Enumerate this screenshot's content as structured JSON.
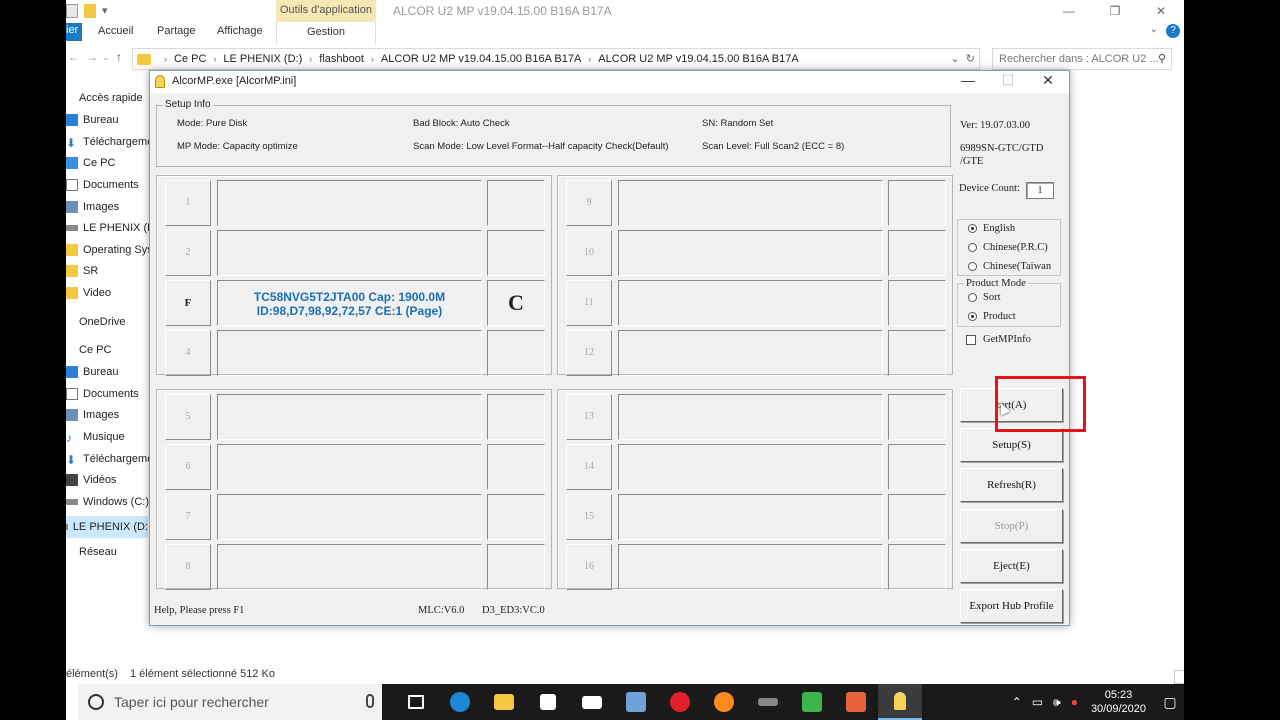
{
  "explorer": {
    "context_tab": "Outils d'application",
    "context_sub": "Gestion",
    "title": "ALCOR U2 MP v19.04.15.00 B16A B17A",
    "tabs": {
      "file": "ier",
      "home": "Accueil",
      "share": "Partage",
      "view": "Affichage"
    },
    "breadcrumb": [
      "Ce PC",
      "LE PHENIX (D:)",
      "flashboot",
      "ALCOR U2 MP v19.04.15.00 B16A B17A",
      "ALCOR U2 MP v19.04.15.00 B16A B17A"
    ],
    "search_placeholder": "Rechercher dans : ALCOR U2 ...",
    "nav": [
      "Accès rapide",
      "Bureau",
      "Téléchargeme",
      "Ce PC",
      "Documents",
      "Images",
      "LE PHENIX (D:",
      "Operating Sys",
      "SR",
      "Video",
      "OneDrive",
      "Ce PC",
      "Bureau",
      "Documents",
      "Images",
      "Musique",
      "Téléchargeme",
      "Vidéos",
      "Windows (C:)",
      "LE PHENIX (D:",
      "Réseau"
    ],
    "status_count": "élément(s)",
    "status_selected": "1 élément sélectionné  512 Ko"
  },
  "taskbar": {
    "search_placeholder": "Taper ici pour rechercher",
    "time": "05:23",
    "date": "30/09/2020"
  },
  "dialog": {
    "title": "AlcorMP.exe [AlcorMP.ini]",
    "setup_legend": "Setup Info",
    "mode": "Mode: Pure Disk",
    "bad_block": "Bad Block: Auto Check",
    "sn": "SN: Random Set",
    "mp_mode": "MP Mode: Capacity optimize",
    "scan_mode": "Scan Mode: Low Level Format--Half capacity Check(Default)",
    "scan_level": "Scan Level: Full Scan2 (ECC = 8)",
    "version": "Ver: 19.07.03.00",
    "chip_line1": "6989SN-GTC/GTD",
    "chip_line2": "/GTE",
    "device_count_label": "Device Count:",
    "device_count": "1",
    "languages": [
      "English",
      "Chinese(P.R.C)",
      "Chinese(Taiwan"
    ],
    "selected_language": "English",
    "product_mode_legend": "Product Mode",
    "product_modes": [
      "Sort",
      "Product"
    ],
    "selected_product_mode": "Product",
    "getmpinfo": "GetMPInfo",
    "buttons": {
      "start": "tart(A)",
      "setup": "Setup(S)",
      "refresh": "Refresh(R)",
      "stop": "Stop(P)",
      "eject": "Eject(E)",
      "export": "Export Hub Profile"
    },
    "help": "Help, Please press F1",
    "mlc": "MLC:V6.0",
    "d3": "D3_ED3:VC.0",
    "ports": {
      "p1": "1",
      "p2": "2",
      "p3": "F",
      "p4": "4",
      "p5": "5",
      "p6": "6",
      "p7": "7",
      "p8": "8",
      "p9": "9",
      "p10": "10",
      "p11": "11",
      "p12": "12",
      "p13": "13",
      "p14": "14",
      "p15": "15",
      "p16": "16"
    },
    "active_port": {
      "line1": "TC58NVG5T2JTA00 Cap: 1900.0M",
      "line2": "ID:98,D7,98,92,72,57 CE:1 (Page)",
      "status": "C"
    }
  }
}
